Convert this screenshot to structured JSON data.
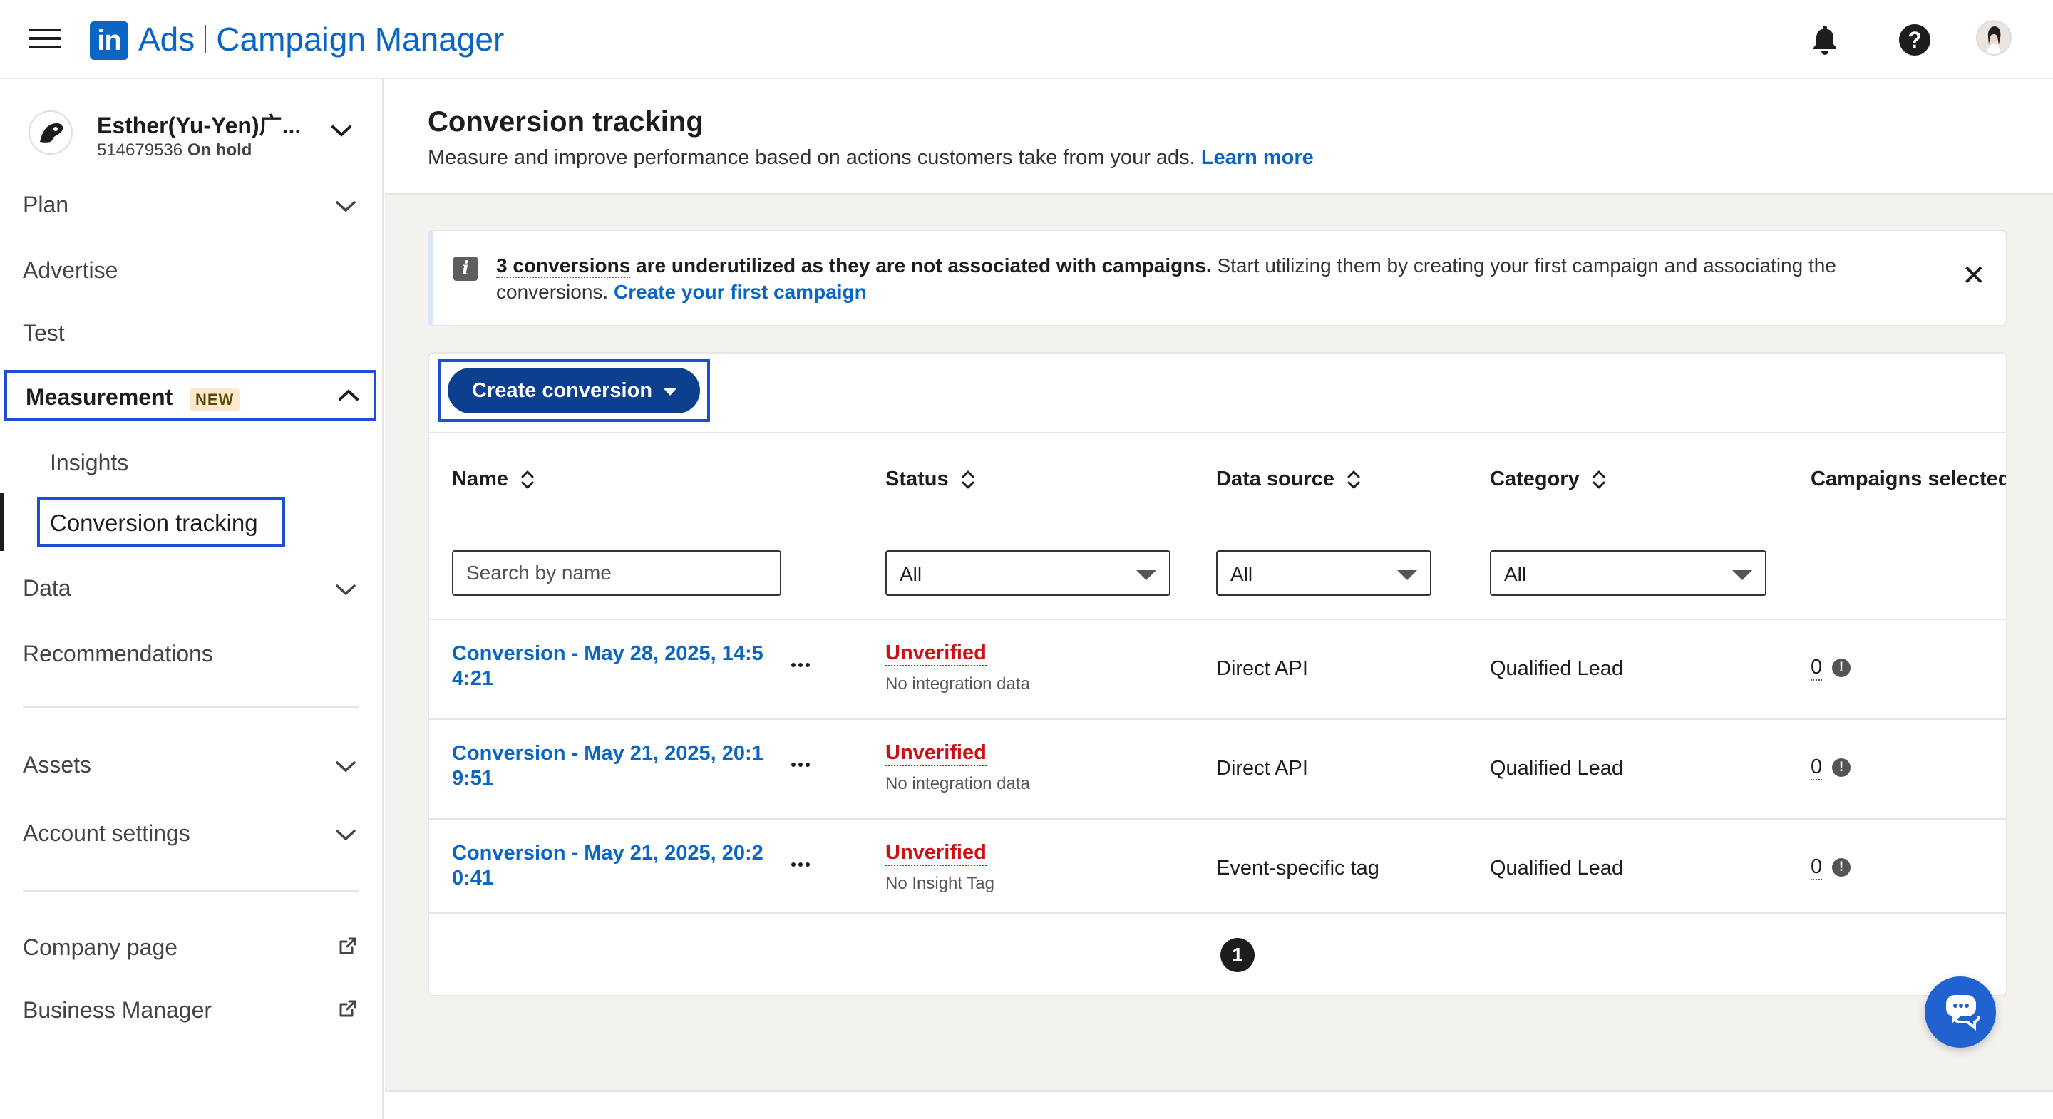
{
  "topbar": {
    "logo_text": "in",
    "brand_ads": "Ads",
    "brand_product": "Campaign Manager"
  },
  "account": {
    "name": "Esther(Yu-Yen)广...",
    "id": "514679536",
    "status": "On hold"
  },
  "sidebar": {
    "plan": "Plan",
    "advertise": "Advertise",
    "test": "Test",
    "measurement": "Measurement",
    "measurement_badge": "NEW",
    "insights": "Insights",
    "conversion_tracking": "Conversion tracking",
    "data": "Data",
    "recommendations": "Recommendations",
    "assets": "Assets",
    "account_settings": "Account settings",
    "company_page": "Company page",
    "business_manager": "Business Manager"
  },
  "page": {
    "title": "Conversion tracking",
    "subtitle": "Measure and improve performance based on actions customers take from your ads.",
    "learn_more": "Learn more"
  },
  "banner": {
    "count_text": "3 conversions",
    "bold_text": " are underutilized as they are not associated with campaigns.",
    "body_text": " Start utilizing them by creating your first campaign and associating the conversions.",
    "link": "Create your first campaign",
    "close": "✕"
  },
  "toolbar": {
    "create_label": "Create conversion"
  },
  "table": {
    "headers": {
      "name": "Name",
      "status": "Status",
      "data_source": "Data source",
      "category": "Category",
      "campaigns": "Campaigns selected"
    },
    "filters": {
      "search_placeholder": "Search by name",
      "status": "All",
      "data_source": "All",
      "category": "All"
    },
    "rows": [
      {
        "name": "Conversion - May 28, 2025, 14:5 4:21",
        "status": "Unverified",
        "status_detail": "No integration data",
        "data_source": "Direct API",
        "category": "Qualified Lead",
        "campaigns": "0"
      },
      {
        "name": "Conversion - May 21, 2025, 20:1 9:51",
        "status": "Unverified",
        "status_detail": "No integration data",
        "data_source": "Direct API",
        "category": "Qualified Lead",
        "campaigns": "0"
      },
      {
        "name": "Conversion - May 21, 2025, 20:2 0:41",
        "status": "Unverified",
        "status_detail": "No Insight Tag",
        "data_source": "Event-specific tag",
        "category": "Qualified Lead",
        "campaigns": "0"
      }
    ],
    "page": "1"
  },
  "colors": {
    "brand_blue": "#0a66c2",
    "button_navy": "#0d3f8f",
    "highlight_box": "#1f4fd1",
    "error_red": "#cc1016",
    "chat_blue": "#1f62d0"
  }
}
